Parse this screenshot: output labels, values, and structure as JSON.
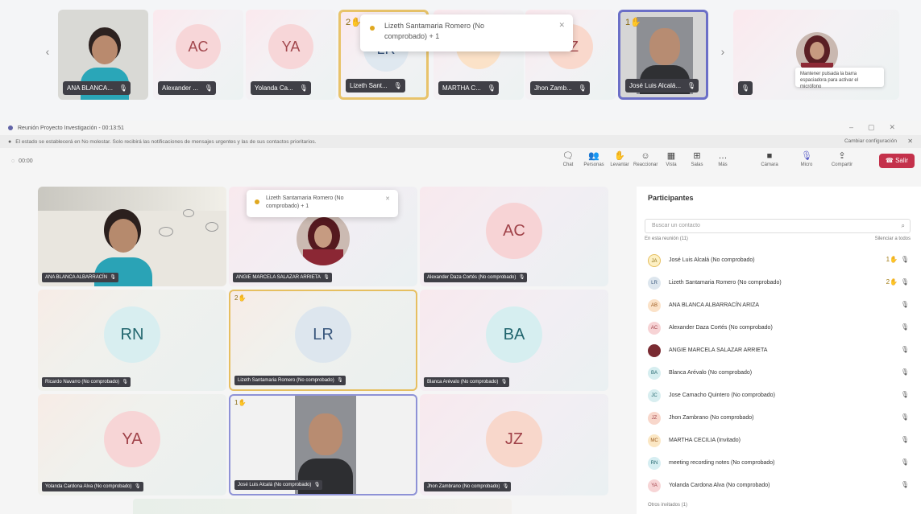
{
  "strip": {
    "prev_arrow": "‹",
    "next_arrow": "›",
    "tiles": [
      {
        "name": "ANA BLANCA...",
        "initials": "",
        "hand": ""
      },
      {
        "name": "Alexander ...",
        "initials": "AC",
        "hand": ""
      },
      {
        "name": "Yolanda Ca...",
        "initials": "YA",
        "hand": ""
      },
      {
        "name": "Lizeth Sant...",
        "initials": "LR",
        "hand": "2"
      },
      {
        "name": "MARTHA C...",
        "initials": "MC",
        "hand": ""
      },
      {
        "name": "Jhon Zamb...",
        "initials": "JZ",
        "hand": ""
      },
      {
        "name": "José Luis Alcalá...",
        "initials": "",
        "hand": "1"
      },
      {
        "name": "",
        "initials": "",
        "hand": ""
      }
    ],
    "toast": {
      "line1": "Lizeth Santamaria Romero (No",
      "line2": "comprobado) + 1"
    }
  },
  "window": {
    "title": "Reunión Proyecto Investigación - 00:13:51",
    "info_text": "El estado se establecerá en No molestar. Solo recibirá las notificaciones de mensajes urgentes y las de sus contactos prioritarios.",
    "info_action": "Cambiar configuración",
    "timer": "00:00",
    "toolbar": {
      "chat": "Chat",
      "people": "Personas",
      "raise": "Levantar",
      "react": "Reaccionar",
      "view": "Vista",
      "rooms": "Salas",
      "more": "Más",
      "camera": "Cámara",
      "mic": "Micro",
      "share": "Compartir",
      "leave": "Salir"
    },
    "tooltip": "Mantener pulsada la barra espaciadora para activar el micrófono"
  },
  "gallery": {
    "toast": {
      "line1": "Lizeth Santamaria Romero (No",
      "line2": "comprobado) + 1"
    },
    "tiles": [
      {
        "name": "ANA BLANCA ALBARRACÍN",
        "initials": "",
        "hand": ""
      },
      {
        "name": "ANGIE MARCELA SALAZAR ARRIETA",
        "initials": "",
        "hand": ""
      },
      {
        "name": "Alexander Daza Cortés (No comprobado)",
        "initials": "AC",
        "hand": ""
      },
      {
        "name": "Ricardo Navarro (No comprobado)",
        "initials": "RN",
        "hand": ""
      },
      {
        "name": "Lizeth Santamaria Romero (No comprobado)",
        "initials": "LR",
        "hand": "2"
      },
      {
        "name": "Blanca Arévalo (No comprobado)",
        "initials": "BA",
        "hand": ""
      },
      {
        "name": "Yolanda Cardona Alva (No comprobado)",
        "initials": "YA",
        "hand": ""
      },
      {
        "name": "José Luis Alcalá (No comprobado)",
        "initials": "",
        "hand": "1"
      },
      {
        "name": "Jhon Zambrano (No comprobado)",
        "initials": "JZ",
        "hand": ""
      }
    ]
  },
  "participants": {
    "title": "Participantes",
    "search_placeholder": "Buscar un contacto",
    "section_label": "En esta reunión (11)",
    "section_action": "Silenciar a todos",
    "rows": [
      {
        "initials": "JA",
        "name": "José Luis Alcalá (No comprobado)",
        "hand": "1"
      },
      {
        "initials": "LR",
        "name": "Lizeth Santamaria Romero (No comprobado)",
        "hand": "2"
      },
      {
        "initials": "AB",
        "name": "ANA BLANCA ALBARRACÍN ARIZA",
        "hand": ""
      },
      {
        "initials": "AC",
        "name": "Alexander Daza Cortés (No comprobado)",
        "hand": ""
      },
      {
        "initials": "",
        "name": "ANGIE MARCELA SALAZAR ARRIETA",
        "hand": ""
      },
      {
        "initials": "BA",
        "name": "Blanca Arévalo (No comprobado)",
        "hand": ""
      },
      {
        "initials": "JC",
        "name": "Jose Camacho Quintero (No comprobado)",
        "hand": ""
      },
      {
        "initials": "JZ",
        "name": "Jhon Zambrano (No comprobado)",
        "hand": ""
      },
      {
        "initials": "MC",
        "name": "MARTHA CECILIA (Invitado)",
        "hand": ""
      },
      {
        "initials": "RN",
        "name": "meeting recording notes (No comprobado)",
        "hand": ""
      },
      {
        "initials": "YA",
        "name": "Yolanda Cardona Alva (No comprobado)",
        "hand": ""
      }
    ],
    "footer": "Otros invitados (1)"
  },
  "colors": {
    "accent": "#5b5fc7",
    "leave": "#c4314b",
    "speaking": "#e6bf60"
  }
}
